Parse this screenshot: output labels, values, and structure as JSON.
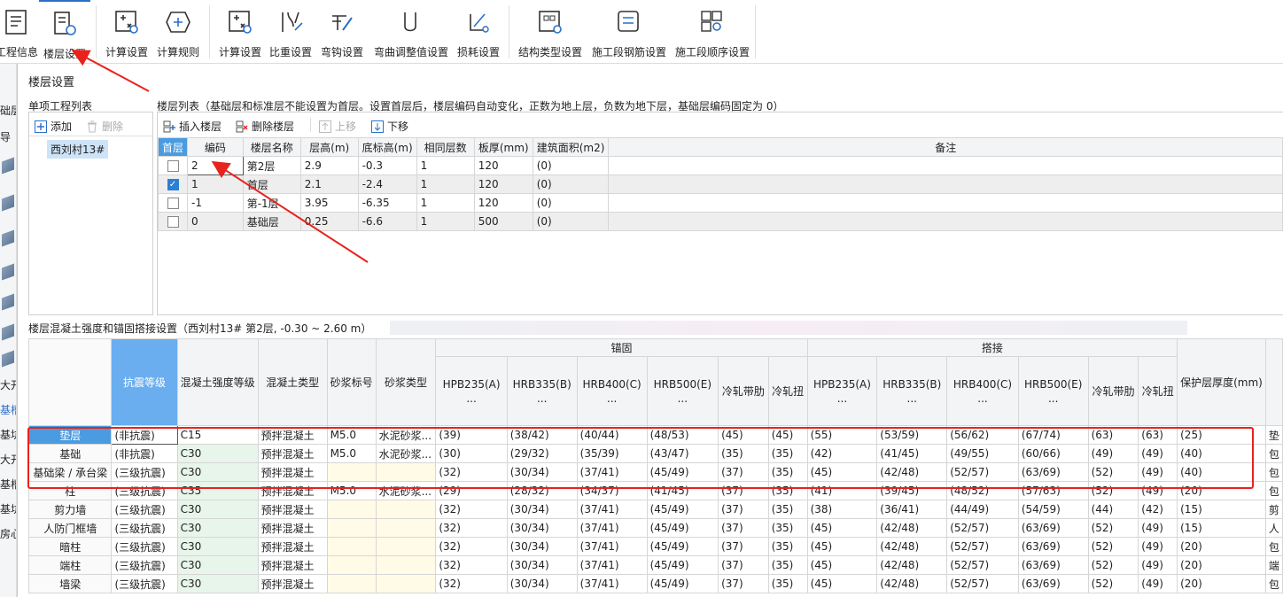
{
  "ribbon": {
    "groups": [
      [
        {
          "label": "工程信息",
          "icon": "project-info-icon"
        },
        {
          "label": "楼层设置",
          "icon": "floor-settings-icon",
          "active": true
        }
      ],
      [
        {
          "label": "计算设置",
          "icon": "calc-settings-icon"
        },
        {
          "label": "计算规则",
          "icon": "calc-rules-icon"
        }
      ],
      [
        {
          "label": "计算设置",
          "icon": "calc-settings-icon"
        },
        {
          "label": "比重设置",
          "icon": "density-settings-icon"
        },
        {
          "label": "弯钩设置",
          "icon": "hook-settings-icon"
        },
        {
          "label": "弯曲调整值设置",
          "icon": "bend-adjust-icon"
        },
        {
          "label": "损耗设置",
          "icon": "loss-settings-icon"
        }
      ],
      [
        {
          "label": "结构类型设置",
          "icon": "structure-type-icon"
        },
        {
          "label": "施工段钢筋设置",
          "icon": "section-rebar-icon"
        },
        {
          "label": "施工段顺序设置",
          "icon": "section-order-icon"
        }
      ]
    ]
  },
  "left_strip": {
    "labels": [
      "础层",
      "导",
      "大开",
      "基槽",
      "基坑",
      "大开",
      "基槽",
      "基坑",
      "房心"
    ]
  },
  "dialog": {
    "title": "楼层设置",
    "project_list_caption": "单项工程列表",
    "add_label": "添加",
    "delete_label": "删除",
    "project_item": "西刘村13#",
    "floor_list_caption": "楼层列表（基础层和标准层不能设置为首层。设置首层后，楼层编码自动变化，正数为地上层，负数为地下层，基础层编码固定为 0）",
    "insert_floor_label": "插入楼层",
    "delete_floor_label": "删除楼层",
    "move_up_label": "上移",
    "move_down_label": "下移",
    "floor_headers": [
      "首层",
      "编码",
      "楼层名称",
      "层高(m)",
      "底标高(m)",
      "相同层数",
      "板厚(mm)",
      "建筑面积(m2)",
      "备注"
    ],
    "floor_rows": [
      {
        "first": false,
        "code": "2",
        "name": "第2层",
        "height": "2.9",
        "bottom": "-0.3",
        "same": "1",
        "slab": "120",
        "area": "(0)",
        "note": ""
      },
      {
        "first": true,
        "code": "1",
        "name": "首层",
        "height": "2.1",
        "bottom": "-2.4",
        "same": "1",
        "slab": "120",
        "area": "(0)",
        "note": ""
      },
      {
        "first": false,
        "code": "-1",
        "name": "第-1层",
        "height": "3.95",
        "bottom": "-6.35",
        "same": "1",
        "slab": "120",
        "area": "(0)",
        "note": ""
      },
      {
        "first": false,
        "code": "0",
        "name": "基础层",
        "height": "0.25",
        "bottom": "-6.6",
        "same": "1",
        "slab": "500",
        "area": "(0)",
        "note": ""
      }
    ],
    "concrete_caption": "楼层混凝土强度和锚固搭接设置（西刘村13#  第2层, -0.30 ~ 2.60 m）"
  },
  "concrete": {
    "group_anchor": "锚固",
    "group_lap": "搭接",
    "headers": {
      "seismic": "抗震等级",
      "grade": "混凝土强度等级",
      "ctype": "混凝土类型",
      "mortar_grade": "砂浆标号",
      "mortar_type": "砂浆类型",
      "cover": "保护层厚度(mm)"
    },
    "rebar_headers": [
      [
        "HPB235(A)",
        "..."
      ],
      [
        "HRB335(B)",
        "..."
      ],
      [
        "HRB400(C)",
        "..."
      ],
      [
        "HRB500(E)",
        "..."
      ],
      [
        "冷轧带肋",
        ""
      ],
      [
        "冷轧扭",
        ""
      ]
    ],
    "rows": [
      {
        "name": "垫层",
        "selected": true,
        "seismic": "(非抗震)",
        "grade": "C15",
        "ctype": "预拌混凝土",
        "mg": "M5.0",
        "mt": "水泥砂浆...",
        "anchor": [
          "(39)",
          "(38/42)",
          "(40/44)",
          "(48/53)",
          "(45)",
          "(45)"
        ],
        "lap": [
          "(55)",
          "(53/59)",
          "(56/62)",
          "(67/74)",
          "(63)",
          "(63)"
        ],
        "cover": "(25)",
        "tail": "垫"
      },
      {
        "name": "基础",
        "selected": false,
        "seismic": "(非抗震)",
        "grade": "C30",
        "ctype": "预拌混凝土",
        "mg": "M5.0",
        "mt": "水泥砂浆...",
        "anchor": [
          "(30)",
          "(29/32)",
          "(35/39)",
          "(43/47)",
          "(35)",
          "(35)"
        ],
        "lap": [
          "(42)",
          "(41/45)",
          "(49/55)",
          "(60/66)",
          "(49)",
          "(49)"
        ],
        "cover": "(40)",
        "tail": "包"
      },
      {
        "name": "基础梁 / 承台梁",
        "selected": false,
        "seismic": "(三级抗震)",
        "grade": "C30",
        "ctype": "预拌混凝土",
        "mg": "",
        "mt": "",
        "anchor": [
          "(32)",
          "(30/34)",
          "(37/41)",
          "(45/49)",
          "(37)",
          "(35)"
        ],
        "lap": [
          "(45)",
          "(42/48)",
          "(52/57)",
          "(63/69)",
          "(52)",
          "(49)"
        ],
        "cover": "(40)",
        "tail": "包"
      },
      {
        "name": "柱",
        "selected": false,
        "seismic": "(三级抗震)",
        "grade": "C35",
        "ctype": "预拌混凝土",
        "mg": "M5.0",
        "mt": "水泥砂浆...",
        "anchor": [
          "(29)",
          "(28/32)",
          "(34/37)",
          "(41/45)",
          "(37)",
          "(35)"
        ],
        "lap": [
          "(41)",
          "(39/45)",
          "(48/52)",
          "(57/63)",
          "(52)",
          "(49)"
        ],
        "cover": "(20)",
        "tail": "包"
      },
      {
        "name": "剪力墙",
        "selected": false,
        "seismic": "(三级抗震)",
        "grade": "C30",
        "ctype": "预拌混凝土",
        "mg": "",
        "mt": "",
        "anchor": [
          "(32)",
          "(30/34)",
          "(37/41)",
          "(45/49)",
          "(37)",
          "(35)"
        ],
        "lap": [
          "(38)",
          "(36/41)",
          "(44/49)",
          "(54/59)",
          "(44)",
          "(42)"
        ],
        "cover": "(15)",
        "tail": "剪"
      },
      {
        "name": "人防门框墙",
        "selected": false,
        "seismic": "(三级抗震)",
        "grade": "C30",
        "ctype": "预拌混凝土",
        "mg": "",
        "mt": "",
        "anchor": [
          "(32)",
          "(30/34)",
          "(37/41)",
          "(45/49)",
          "(37)",
          "(35)"
        ],
        "lap": [
          "(45)",
          "(42/48)",
          "(52/57)",
          "(63/69)",
          "(52)",
          "(49)"
        ],
        "cover": "(15)",
        "tail": "人"
      },
      {
        "name": "暗柱",
        "selected": false,
        "seismic": "(三级抗震)",
        "grade": "C30",
        "ctype": "预拌混凝土",
        "mg": "",
        "mt": "",
        "anchor": [
          "(32)",
          "(30/34)",
          "(37/41)",
          "(45/49)",
          "(37)",
          "(35)"
        ],
        "lap": [
          "(45)",
          "(42/48)",
          "(52/57)",
          "(63/69)",
          "(52)",
          "(49)"
        ],
        "cover": "(20)",
        "tail": "包"
      },
      {
        "name": "端柱",
        "selected": false,
        "seismic": "(三级抗震)",
        "grade": "C30",
        "ctype": "预拌混凝土",
        "mg": "",
        "mt": "",
        "anchor": [
          "(32)",
          "(30/34)",
          "(37/41)",
          "(45/49)",
          "(37)",
          "(35)"
        ],
        "lap": [
          "(45)",
          "(42/48)",
          "(52/57)",
          "(63/69)",
          "(52)",
          "(49)"
        ],
        "cover": "(20)",
        "tail": "端"
      },
      {
        "name": "墙梁",
        "selected": false,
        "seismic": "(三级抗震)",
        "grade": "C30",
        "ctype": "预拌混凝土",
        "mg": "",
        "mt": "",
        "anchor": [
          "(32)",
          "(30/34)",
          "(37/41)",
          "(45/49)",
          "(37)",
          "(35)"
        ],
        "lap": [
          "(45)",
          "(42/48)",
          "(52/57)",
          "(63/69)",
          "(52)",
          "(49)"
        ],
        "cover": "(20)",
        "tail": "包"
      }
    ]
  },
  "colors": {
    "accent": "#2b6fc9",
    "selected_header": "#4a9be0",
    "annotation_red": "#e8221d",
    "grade_cell": "#e8f5ea",
    "mortar_cell": "#fffbe6"
  }
}
